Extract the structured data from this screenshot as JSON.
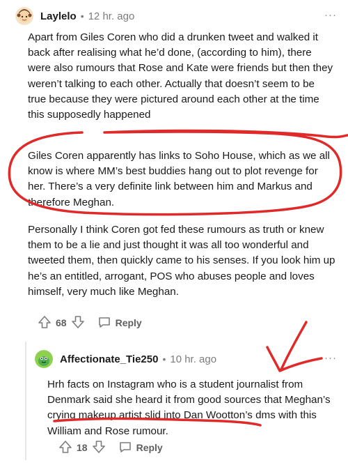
{
  "comments": [
    {
      "username": "Laylelo",
      "separator": "•",
      "time": "12 hr. ago",
      "paragraphs": [
        "Apart from Giles Coren who did a drunken tweet and walked it back after realising what he’d done, (according to him), there were also rumours that Rose and Kate were friends but then they weren’t talking to each other. Actually that doesn’t seem to be true because they were pictured around each other at the time this supposedly happened",
        "Giles Coren apparently has links to Soho House, which as we all know is where MM’s best buddies hang out to plot revenge for her. There’s a very definite link between him and Markus and therefore Meghan.",
        "Personally I think Coren got fed these rumours as truth or knew them to be a lie and just thought it was all too wonderful and tweeted them, then quickly came to his senses. If you look him up he’s an entitled, arrogant, POS who abuses people and loves himself, very much like Meghan."
      ],
      "votes": "68",
      "reply_label": "Reply",
      "more": "···"
    },
    {
      "username": "Affectionate_Tie250",
      "separator": "•",
      "time": "10 hr. ago",
      "paragraphs": [
        "Hrh facts on Instagram who is a student journalist from Denmark said she heard it from good sources that Meghan’s crying makeup artist slid into Dan Wootton’s dms with this William and Rose rumour."
      ],
      "votes": "18",
      "reply_label": "Reply",
      "more": "···"
    }
  ],
  "colors": {
    "annotation": "#e02a2a",
    "meta_text": "#7c7c7c",
    "body_text": "#1a1a1b"
  },
  "icons": [
    "user-avatar-icon",
    "upvote-icon",
    "downvote-icon",
    "reply-icon",
    "more-options-icon"
  ]
}
